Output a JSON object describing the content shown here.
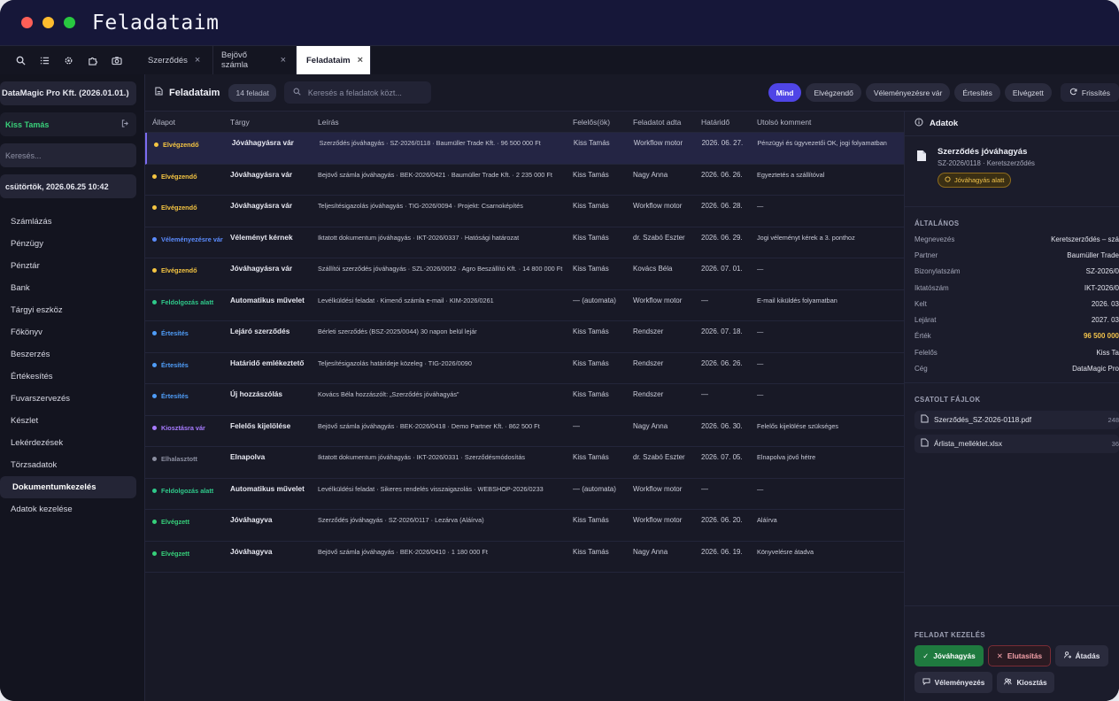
{
  "window": {
    "title": "Feladataim",
    "controls": {
      "close_color": "#fe5f57",
      "minimize_color": "#febc2e",
      "maximize_color": "#28c840"
    }
  },
  "toolbar_icons": [
    "search-icon",
    "list-icon",
    "gear-icon",
    "puzzle-icon",
    "camera-icon"
  ],
  "tabs": [
    {
      "label": "Szerződés",
      "close": "×"
    },
    {
      "label": "Bejövő számla",
      "close": "×"
    },
    {
      "label": "Feladataim",
      "close": "×",
      "active": true
    }
  ],
  "sidebar": {
    "company": "DataMagic Pro Kft. (2026.01.01.)",
    "user": "Kiss Tamás",
    "search_placeholder": "Keresés...",
    "datetime": "csütörtök, 2026.06.25 10:42",
    "items": [
      {
        "label": "Számlázás"
      },
      {
        "label": "Pénzügy"
      },
      {
        "label": "Pénztár"
      },
      {
        "label": "Bank"
      },
      {
        "label": "Tárgyi eszköz"
      },
      {
        "label": "Főkönyv"
      },
      {
        "label": "Beszerzés"
      },
      {
        "label": "Értékesítés"
      },
      {
        "label": "Fuvarszervezés"
      },
      {
        "label": "Készlet"
      },
      {
        "label": "Lekérdezések"
      },
      {
        "label": "Törzsadatok"
      },
      {
        "label": "Dokumentumkezelés",
        "active": true
      },
      {
        "label": "Adatok kezelése"
      }
    ]
  },
  "main": {
    "title": "Feladataim",
    "count": "14 feladat",
    "search_placeholder": "Keresés a feladatok közt...",
    "filters": [
      {
        "label": "Mind",
        "active": true
      },
      {
        "label": "Elvégzendő"
      },
      {
        "label": "Véleményezésre vár"
      },
      {
        "label": "Értesítés"
      },
      {
        "label": "Elvégzett"
      }
    ],
    "refresh_label": "Frissítés",
    "columns": [
      "Állapot",
      "Tárgy",
      "Leírás",
      "Felelős(ök)",
      "Feladatot adta",
      "Határidő",
      "Utolsó komment"
    ],
    "status_colors": {
      "Elvégzendő": "#f5c542",
      "Véleményezésre vár": "#5b8cff",
      "Feldolgozás alatt": "#2fc98a",
      "Értesítés": "#4f9df8",
      "Kiosztásra vár": "#a77bff",
      "Elhalasztott": "#8b8ea0",
      "Elvégzett": "#36d07a"
    },
    "rows": [
      {
        "status": "Elvégzendő",
        "subject": "Jóváhagyásra vár",
        "desc": "Szerződés jóváhagyás · SZ-2026/0118 · Baumüller Trade Kft. · 96 500 000 Ft",
        "owner": "Kiss Tamás",
        "giver": "Workflow motor",
        "due": "2026. 06. 27.",
        "comment": "Pénzügyi és ügyvezetői OK, jogi folyamatban",
        "selected": true
      },
      {
        "status": "Elvégzendő",
        "subject": "Jóváhagyásra vár",
        "desc": "Bejövő számla jóváhagyás · BEK-2026/0421 · Baumüller Trade Kft. · 2 235 000 Ft",
        "owner": "Kiss Tamás",
        "giver": "Nagy Anna",
        "due": "2026. 06. 26.",
        "comment": "Egyeztetés a szállítóval"
      },
      {
        "status": "Elvégzendő",
        "subject": "Jóváhagyásra vár",
        "desc": "Teljesítésigazolás jóváhagyás · TIG-2026/0094 · Projekt: Csarnoképítés",
        "owner": "Kiss Tamás",
        "giver": "Workflow motor",
        "due": "2026. 06. 28.",
        "comment": "—"
      },
      {
        "status": "Véleményezésre vár",
        "subject": "Véleményt kérnek",
        "desc": "Iktatott dokumentum jóváhagyás · IKT-2026/0337 · Hatósági határozat",
        "owner": "Kiss Tamás",
        "giver": "dr. Szabó Eszter",
        "due": "2026. 06. 29.",
        "comment": "Jogi véleményt kérek a 3. ponthoz"
      },
      {
        "status": "Elvégzendő",
        "subject": "Jóváhagyásra vár",
        "desc": "Szállítói szerződés jóváhagyás · SZL-2026/0052 · Agro Beszállító Kft. · 14 800 000 Ft",
        "owner": "Kiss Tamás",
        "giver": "Kovács Béla",
        "due": "2026. 07. 01.",
        "comment": "—"
      },
      {
        "status": "Feldolgozás alatt",
        "subject": "Automatikus művelet",
        "desc": "Levélküldési feladat · Kimenő számla e-mail · KIM-2026/0261",
        "owner": "— (automata)",
        "giver": "Workflow motor",
        "due": "—",
        "comment": "E-mail kiküldés folyamatban"
      },
      {
        "status": "Értesítés",
        "subject": "Lejáró szerződés",
        "desc": "Bérleti szerződés (BSZ-2025/0044) 30 napon belül lejár",
        "owner": "Kiss Tamás",
        "giver": "Rendszer",
        "due": "2026. 07. 18.",
        "comment": "—"
      },
      {
        "status": "Értesítés",
        "subject": "Határidő emlékeztető",
        "desc": "Teljesítésigazolás határideje közeleg · TIG-2026/0090",
        "owner": "Kiss Tamás",
        "giver": "Rendszer",
        "due": "2026. 06. 26.",
        "comment": "—"
      },
      {
        "status": "Értesítés",
        "subject": "Új hozzászólás",
        "desc": "Kovács Béla hozzászólt: „Szerződés jóváhagyás”",
        "owner": "Kiss Tamás",
        "giver": "Rendszer",
        "due": "—",
        "comment": "—"
      },
      {
        "status": "Kiosztásra vár",
        "subject": "Felelős kijelölése",
        "desc": "Bejövő számla jóváhagyás · BEK-2026/0418 · Demo Partner Kft. · 862 500 Ft",
        "owner": "—",
        "giver": "Nagy Anna",
        "due": "2026. 06. 30.",
        "comment": "Felelős kijelölése szükséges"
      },
      {
        "status": "Elhalasztott",
        "subject": "Elnapolva",
        "desc": "Iktatott dokumentum jóváhagyás · IKT-2026/0331 · Szerződésmódosítás",
        "owner": "Kiss Tamás",
        "giver": "dr. Szabó Eszter",
        "due": "2026. 07. 05.",
        "comment": "Elnapolva jövő hétre"
      },
      {
        "status": "Feldolgozás alatt",
        "subject": "Automatikus művelet",
        "desc": "Levélküldési feladat · Sikeres rendelés visszaigazolás · WEBSHOP-2026/0233",
        "owner": "— (automata)",
        "giver": "Workflow motor",
        "due": "—",
        "comment": "—"
      },
      {
        "status": "Elvégzett",
        "subject": "Jóváhagyva",
        "desc": "Szerződés jóváhagyás · SZ-2026/0117 · Lezárva (Aláírva)",
        "owner": "Kiss Tamás",
        "giver": "Workflow motor",
        "due": "2026. 06. 20.",
        "comment": "Aláírva"
      },
      {
        "status": "Elvégzett",
        "subject": "Jóváhagyva",
        "desc": "Bejövő számla jóváhagyás · BEK-2026/0410 · 1 180 000 Ft",
        "owner": "Kiss Tamás",
        "giver": "Nagy Anna",
        "due": "2026. 06. 19.",
        "comment": "Könyvelésre átadva"
      }
    ]
  },
  "panel": {
    "title": "Adatok",
    "doc_title": "Szerződés jóváhagyás",
    "doc_sub": "SZ-2026/0118 · Keretszerződés",
    "badge": "Jóváhagyás alatt",
    "general_label": "ÁLTALÁNOS",
    "fields": [
      {
        "k": "Megnevezés",
        "v": "Keretszerződés – szá"
      },
      {
        "k": "Partner",
        "v": "Baumüller Trade"
      },
      {
        "k": "Bizonylatszám",
        "v": "SZ-2026/0"
      },
      {
        "k": "Iktatószám",
        "v": "IKT-2026/0"
      },
      {
        "k": "Kelt",
        "v": "2026. 03"
      },
      {
        "k": "Lejárat",
        "v": "2027. 03"
      },
      {
        "k": "Érték",
        "v": "96 500 000",
        "highlight": true
      },
      {
        "k": "Felelős",
        "v": "Kiss Ta"
      },
      {
        "k": "Cég",
        "v": "DataMagic Pro"
      }
    ],
    "files_label": "CSATOLT FÁJLOK",
    "files": [
      {
        "name": "Szerződés_SZ-2026-0118.pdf",
        "size": "248"
      },
      {
        "name": "Árlista_melléklet.xlsx",
        "size": "36"
      }
    ],
    "actions_label": "FELADAT KEZELÉS",
    "actions": {
      "approve": "Jóváhagyás",
      "reject": "Elutasítás",
      "transfer": "Átadás",
      "review": "Véleményezés",
      "assign": "Kiosztás"
    }
  }
}
